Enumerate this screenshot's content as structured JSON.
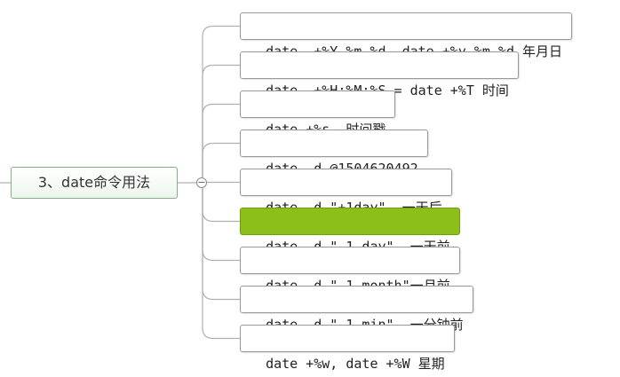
{
  "root": {
    "label": "3、date命令用法"
  },
  "theme": {
    "line_color": "#b0b0b0",
    "highlight_color": "#8cbf1a",
    "root_border": "#7fb07f"
  },
  "children": [
    {
      "cmd": "date  +%Y-%m-%d, date +%y-%m-%d ",
      "desc": "年月日"
    },
    {
      "cmd": "date  +%H:%M:%S = date +%T ",
      "desc": "时间"
    },
    {
      "cmd": "date +%s  ",
      "desc": "时间戳"
    },
    {
      "cmd": "date -d @1504620492",
      "desc": ""
    },
    {
      "cmd": "date -d \"+1day\"  ",
      "desc": "一天后"
    },
    {
      "cmd": "date -d \"-1 day\"  ",
      "desc": "一天前",
      "highlighted": true
    },
    {
      "cmd": "date -d \"-1 month\"",
      "desc": "一月前"
    },
    {
      "cmd": "date -d \"-1 min\"  ",
      "desc": "一分钟前"
    },
    {
      "cmd": "date +%w, date +%W ",
      "desc": "星期"
    }
  ]
}
